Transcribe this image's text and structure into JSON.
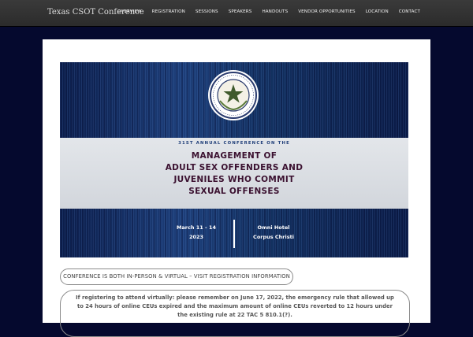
{
  "header": {
    "site_title": "Texas CSOT Conference",
    "nav": [
      "OVERVIEW",
      "REGISTRATION",
      "SESSIONS",
      "SPEAKERS",
      "HANDOUTS",
      "VENDOR OPPORTUNITIES",
      "LOCATION",
      "CONTACT"
    ]
  },
  "banner": {
    "seal_icon": "texas-seal-icon",
    "subtitle": "31ST ANNUAL CONFERENCE ON THE",
    "title_lines": [
      "MANAGEMENT OF",
      "ADULT SEX OFFENDERS AND",
      "JUVENILES WHO COMMIT",
      "SEXUAL OFFENSES"
    ],
    "date_lines": [
      "March 11 - 14",
      "2023"
    ],
    "venue_lines": [
      "Omni Hotel",
      "Corpus Christi"
    ]
  },
  "registration_button": {
    "label": "CONFERENCE IS BOTH IN-PERSON & VIRTUAL – VISIT REGISTRATION INFORMATION"
  },
  "notice": {
    "text": "If registering to attend virtually: please remember on June 17, 2022, the emergency rule that allowed up to 24 hours of online CEUs expired and the maximum amount of online CEUs reverted to 12 hours under the existing rule at 22 TAC 5 810.1(?)."
  },
  "colors": {
    "page_background": "#05092e",
    "topbar": "#2f2f2f",
    "title_maroon": "#3b1130",
    "subtitle_blue": "#1e3d78"
  }
}
